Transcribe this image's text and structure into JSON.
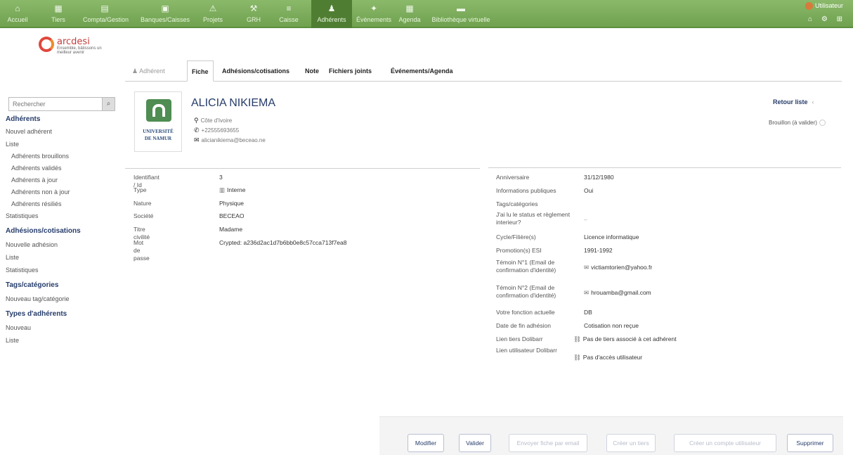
{
  "topbar": {
    "menu": [
      {
        "icon": "home-icon",
        "label": "Accueil"
      },
      {
        "icon": "chart-icon",
        "label": "Tiers"
      },
      {
        "icon": "chart-icon",
        "label": "Compta/Gestion"
      },
      {
        "icon": "bank-icon",
        "label": "Banques/Caisses"
      },
      {
        "icon": "project-icon",
        "label": "Projets"
      },
      {
        "icon": "tool-icon",
        "label": "GRH"
      },
      {
        "icon": "cash-icon",
        "label": "Caisse"
      },
      {
        "icon": "members-icon",
        "label": "Adhérents"
      },
      {
        "icon": "ticket-icon",
        "label": "Évènements"
      },
      {
        "icon": "calendar-icon",
        "label": "Agenda"
      },
      {
        "icon": "library-icon",
        "label": "Bibliothèque virtuelle"
      }
    ],
    "user_name": "Utilisateur",
    "user_icons": "⌂ ⚙ ⊞"
  },
  "logo": {
    "brand": "arcdesi",
    "tagline": "Ensemble, bâtissons un meilleur avenir"
  },
  "search": {
    "placeholder": "Rechercher",
    "button": "⌕"
  },
  "leftnav": {
    "groups": [
      {
        "title": "Adhérents",
        "items": [
          "Nouvel adhérent",
          "Liste"
        ],
        "subitems": [
          "Adhérents brouillons",
          "Adhérents validés",
          "Adhérents à jour",
          "Adhérents non à jour",
          "Adhérents résiliés"
        ],
        "tail": [
          "Statistiques"
        ]
      },
      {
        "title": "Adhésions/cotisations",
        "items": [
          "Nouvelle adhésion",
          "Liste",
          "Statistiques"
        ]
      },
      {
        "title": "Tags/catégories",
        "items": [
          "Nouveau tag/catégorie"
        ]
      },
      {
        "title": "Types d'adhérents",
        "items": [
          "Nouveau",
          "Liste"
        ]
      }
    ]
  },
  "tabs": [
    "Adhérent",
    "Fiche",
    "Adhésions/cotisations",
    "Note",
    "Fichiers joints",
    "Événements/Agenda"
  ],
  "member": {
    "university_line1": "UNIVERSITÉ",
    "university_line2": "DE NAMUR",
    "name": "ALICIA NIKIEMA",
    "country": "Côte d'Ivoire",
    "phone": "+22555693655",
    "email": "alicianikiema@beceao.ne"
  },
  "header_right": {
    "back_list": "Retour liste",
    "arrow": "‹",
    "status": "Brouillon (à valider)"
  },
  "left_fields": [
    {
      "label": "Identifiant / Id",
      "value": "3"
    },
    {
      "label": "Type",
      "value": "Interne",
      "icon": "type-icon"
    },
    {
      "label": "Nature",
      "value": "Physique"
    },
    {
      "label": "Société",
      "value": "BECEAO"
    },
    {
      "label": "Titre civilité",
      "value": "Madame"
    },
    {
      "label": "Mot de passe",
      "value": "Crypted: a236d2ac1d7b6bb0e8c57cca713f7ea8"
    }
  ],
  "right_fields": [
    {
      "label": "Anniversaire",
      "value": "31/12/1980"
    },
    {
      "label": "Informations publiques",
      "value": "Oui"
    },
    {
      "label": "Tags/catégories",
      "value": ""
    },
    {
      "label": "J'ai lu le status et règlement interieur?",
      "value": "–"
    },
    {
      "label": "Cycle/Filière(s)",
      "value": "Licence informatique"
    },
    {
      "label": "Promotion(s) ESI",
      "value": "1991-1992"
    },
    {
      "label": "Témoin N°1 (Email de confirmation d'identité)",
      "value": "victiamtorien@yahoo.fr",
      "icon": "mail-icon"
    },
    {
      "label": "Témoin N°2 (Email de confirmation d'identité)",
      "value": "hrouamba@gmail.com",
      "icon": "mail-icon"
    },
    {
      "label": "Votre fonction actuelle",
      "value": "DB"
    },
    {
      "label": "Date de fin adhésion",
      "value": "Cotisation non reçue"
    },
    {
      "label": "Lien tiers Dolibarr",
      "value": "Pas de tiers associé à cet adhérent",
      "icon": "link-icon"
    },
    {
      "label": "Lien utilisateur Dolibarr",
      "value": "Pas d'accès utilisateur",
      "icon": "link-icon"
    }
  ],
  "buttons": [
    {
      "label": "Modifier",
      "disabled": false
    },
    {
      "label": "Valider",
      "disabled": false
    },
    {
      "label": "Envoyer fiche par email",
      "disabled": true
    },
    {
      "label": "Créer un tiers",
      "disabled": true
    },
    {
      "label": "Créer un compte utilisateur",
      "disabled": true
    },
    {
      "label": "Supprimer",
      "disabled": false
    }
  ]
}
